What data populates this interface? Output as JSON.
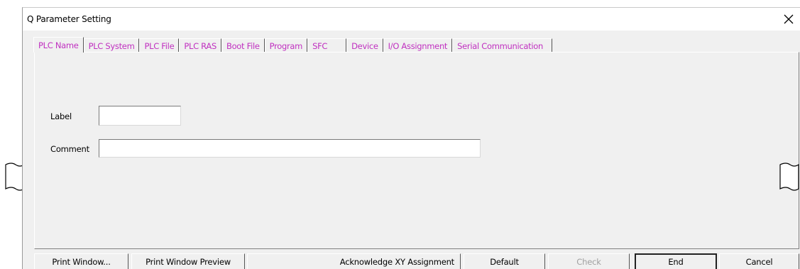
{
  "window": {
    "title": "Q Parameter Setting",
    "close_symbol": "✕"
  },
  "tabs": [
    {
      "label": "PLC Name",
      "active": true
    },
    {
      "label": "PLC System"
    },
    {
      "label": "PLC File"
    },
    {
      "label": "PLC RAS"
    },
    {
      "label": "Boot File"
    },
    {
      "label": "Program"
    },
    {
      "label": "SFC"
    },
    {
      "label": "Device"
    },
    {
      "label": "I/O Assignment"
    },
    {
      "label": "Serial Communication"
    }
  ],
  "form": {
    "label_caption": "Label",
    "label_value": "",
    "comment_caption": "Comment",
    "comment_value": ""
  },
  "buttons": {
    "print_window": "Print Window...",
    "print_window_preview": "Print Window Preview",
    "acknowledge_xy": "Acknowledge XY Assignment",
    "default": "Default",
    "check": "Check",
    "end": "End",
    "cancel": "Cancel"
  },
  "colors": {
    "tab_text": "#c030c0",
    "dialog_bg": "#f0f0f0"
  },
  "icons": {
    "close": "close-icon",
    "break_left": "wave-break-icon",
    "break_right": "wave-break-icon"
  }
}
